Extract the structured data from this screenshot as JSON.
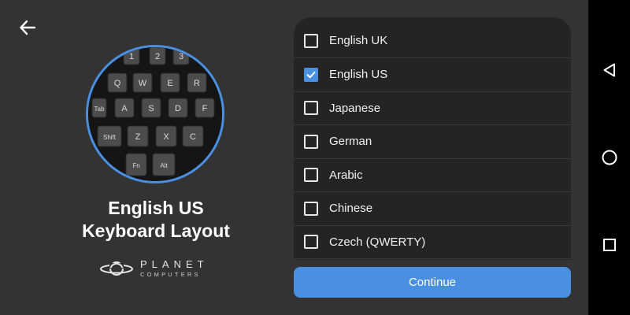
{
  "header": {
    "back_icon": "arrow-left-icon"
  },
  "hero": {
    "title_line1": "English US",
    "title_line2": "Keyboard Layout",
    "keyboard_keys": [
      {
        "label": "1"
      },
      {
        "label": "2"
      },
      {
        "label": "3"
      },
      {
        "label": "Q"
      },
      {
        "label": "W"
      },
      {
        "label": "E"
      },
      {
        "label": "R"
      },
      {
        "label": "Tab"
      },
      {
        "label": "A"
      },
      {
        "label": "S"
      },
      {
        "label": "D"
      },
      {
        "label": "F"
      },
      {
        "label": "Shift"
      },
      {
        "label": "Z"
      },
      {
        "label": "X"
      },
      {
        "label": "C"
      },
      {
        "label": "Fn"
      },
      {
        "label": "Alt"
      }
    ]
  },
  "brand": {
    "name": "PLANET",
    "sub": "COMPUTERS"
  },
  "layout_list": {
    "items": [
      {
        "label": "English UK",
        "checked": false
      },
      {
        "label": "English US",
        "checked": true
      },
      {
        "label": "Japanese",
        "checked": false
      },
      {
        "label": "German",
        "checked": false
      },
      {
        "label": "Arabic",
        "checked": false
      },
      {
        "label": "Chinese",
        "checked": false
      },
      {
        "label": "Czech (QWERTY)",
        "checked": false
      }
    ]
  },
  "continue_label": "Continue",
  "navbar": {
    "back": "triangle-back-icon",
    "home": "circle-home-icon",
    "recents": "square-recents-icon"
  },
  "colors": {
    "accent": "#4a90e2",
    "background": "#333333",
    "list_background": "#242424",
    "navbar": "#000000"
  }
}
